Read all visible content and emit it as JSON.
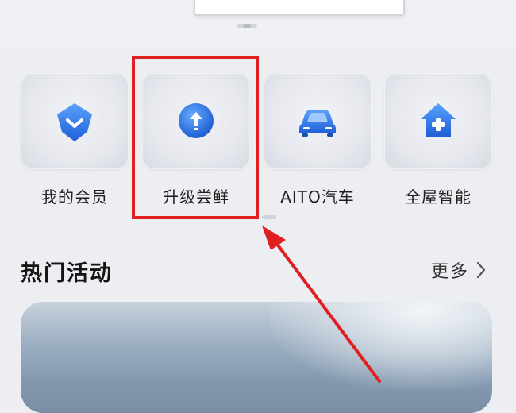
{
  "quick_entries": [
    {
      "label": "我的会员",
      "icon": "diamond-check-icon"
    },
    {
      "label": "升级尝鲜",
      "icon": "upgrade-arrow-icon"
    },
    {
      "label": "AITO汽车",
      "icon": "car-icon"
    },
    {
      "label": "全屋智能",
      "icon": "smart-home-icon"
    }
  ],
  "hot_activities": {
    "title": "热门活动",
    "more_label": "更多"
  },
  "colors": {
    "icon_blue": "#1f6fe0",
    "icon_blue_light": "#5aa2ff",
    "annotation_red": "#e02020",
    "background": "#eceef1"
  },
  "annotations": {
    "highlighted_entry": "升级尝鲜"
  }
}
